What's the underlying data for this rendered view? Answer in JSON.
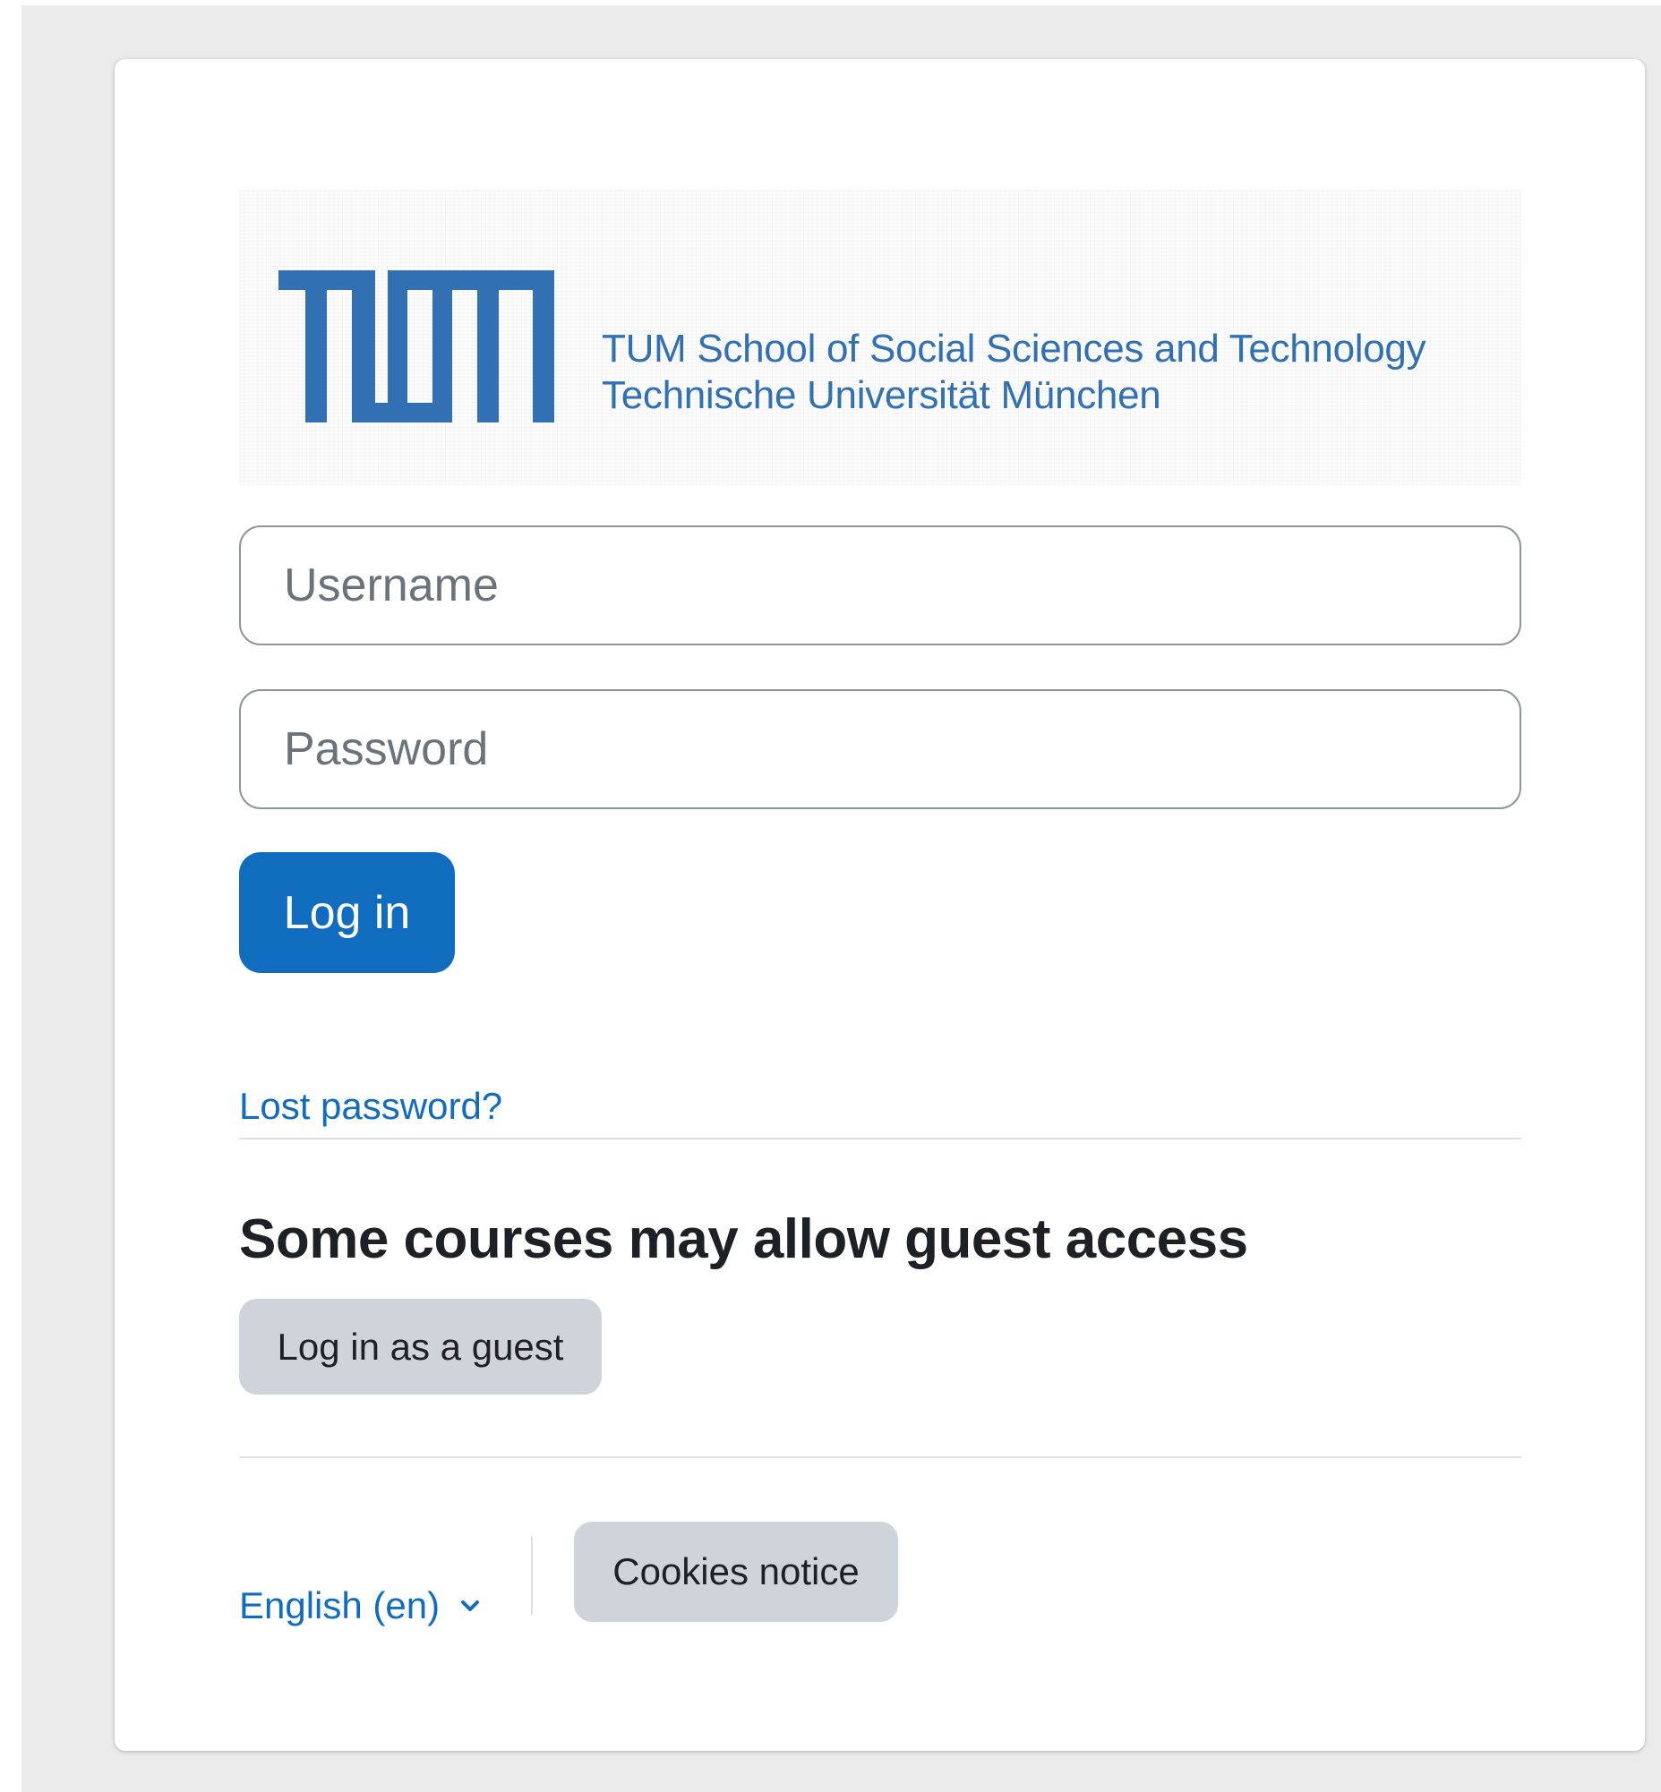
{
  "branding": {
    "logo_alt": "TUM",
    "line1": "TUM School of Social Sciences and Technology",
    "line2": "Technische Universität München",
    "brand_color": "#3070b3"
  },
  "login_form": {
    "username_placeholder": "Username",
    "password_placeholder": "Password",
    "username_value": "",
    "password_value": "",
    "login_label": "Log in",
    "lost_password_label": "Lost password?",
    "accent_color": "#0f6cbf"
  },
  "guest": {
    "heading": "Some courses may allow guest access",
    "button_label": "Log in as a guest"
  },
  "footer": {
    "language_label": "English (en)",
    "language_icon": "chevron-down-icon",
    "cookies_label": "Cookies notice"
  }
}
